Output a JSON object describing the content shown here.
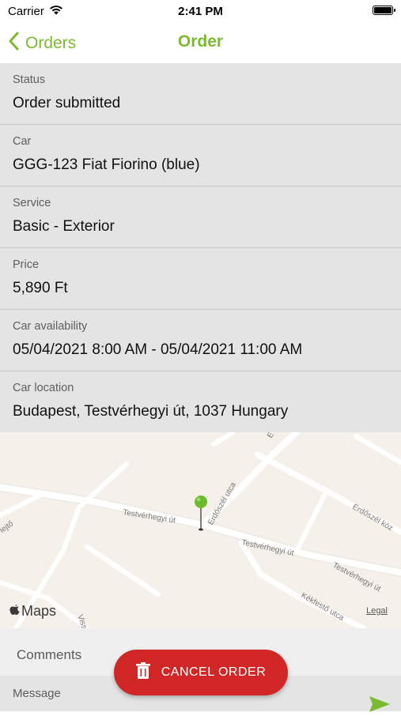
{
  "status_bar": {
    "carrier": "Carrier",
    "time": "2:41 PM"
  },
  "nav": {
    "back_label": "Orders",
    "title": "Order"
  },
  "fields": [
    {
      "label": "Status",
      "value": "Order submitted"
    },
    {
      "label": "Car",
      "value": "GGG-123 Fiat Fiorino (blue)"
    },
    {
      "label": "Service",
      "value": "Basic - Exterior"
    },
    {
      "label": "Price",
      "value": "5,890 Ft"
    },
    {
      "label": "Car availability",
      "value": "05/04/2021 8:00 AM - 05/04/2021 11:00 AM"
    },
    {
      "label": "Car location",
      "value": "Budapest, Testvérhegyi út, 1037 Hungary"
    }
  ],
  "map": {
    "brand": "Maps",
    "legal": "Legal",
    "streets": [
      "Testvérhegyi út",
      "Testvérhegyi út",
      "Testvérhegyi út",
      "Erdőszél utca",
      "Erdőszél köz",
      "Kékfestő utca",
      "s lejtő",
      "Viss",
      "E"
    ],
    "pin_color": "#6cbb2a"
  },
  "comments": {
    "label": "Comments"
  },
  "message": {
    "label": "Message"
  },
  "cancel_button": {
    "label": "CANCEL ORDER"
  },
  "colors": {
    "accent": "#7cba32",
    "danger": "#d12626"
  }
}
